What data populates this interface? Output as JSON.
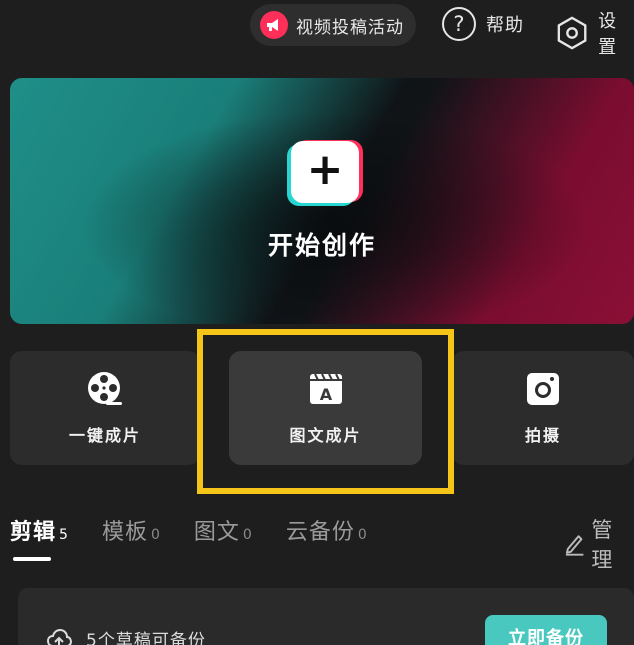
{
  "topbar": {
    "event_label": "视频投稿活动",
    "help_label": "帮助",
    "settings_label": "设置"
  },
  "hero": {
    "title": "开始创作"
  },
  "quick_actions": [
    {
      "label": "一键成片",
      "icon": "film-reel-icon"
    },
    {
      "label": "图文成片",
      "icon": "text-to-video-icon"
    },
    {
      "label": "拍摄",
      "icon": "camera-icon"
    }
  ],
  "tabs": [
    {
      "label": "剪辑",
      "count": "5",
      "active": true
    },
    {
      "label": "模板",
      "count": "0",
      "active": false
    },
    {
      "label": "图文",
      "count": "0",
      "active": false
    },
    {
      "label": "云备份",
      "count": "0",
      "active": false
    }
  ],
  "manage_label": "管理",
  "backup": {
    "text": "5个草稿可备份",
    "button_label": "立即备份"
  },
  "colors": {
    "accent": "#48c8be",
    "brand_red": "#ff2f5a",
    "brand_cyan": "#27d6d0",
    "highlight": "#f5c518",
    "background": "#1e1e1e"
  }
}
